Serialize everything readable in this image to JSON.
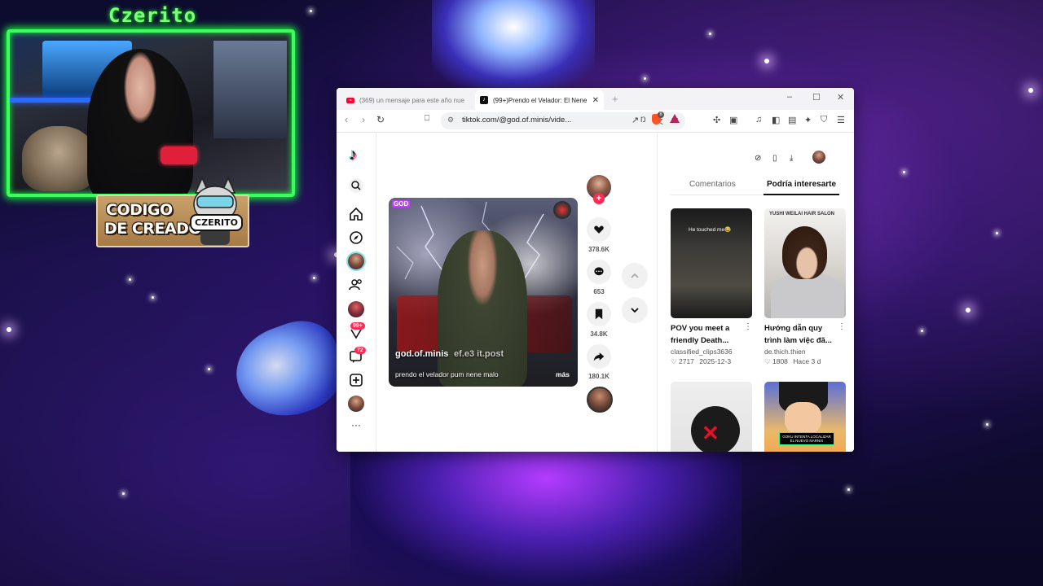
{
  "overlay": {
    "streamer_name": "Czerito",
    "badge_line1": "CODIGO",
    "badge_line2": "DE CREADOR",
    "badge_tag": "CZERITO"
  },
  "browser": {
    "tabs": [
      {
        "title": "(369) un mensaje para este año nue",
        "icon": "youtube-icon",
        "active": false
      },
      {
        "title": "(99+)Prendo el Velador: El Nene",
        "icon": "tiktok-icon",
        "active": true
      }
    ],
    "new_tab": "+",
    "url": "tiktok.com/@god.of.minis/vide...",
    "window_controls": {
      "minimize": "–",
      "maximize": "☐",
      "close": "✕"
    }
  },
  "tiktok": {
    "logo": "♪",
    "nav": {
      "messages_badge": "99+",
      "inbox_badge": "72",
      "more": "···"
    },
    "video": {
      "username": "god.of.minis",
      "overlay_ghost": "ef.e3 it.post",
      "description": "prendo el velador pum nene malo",
      "more_label": "más",
      "corner_tag": "GOD"
    },
    "actions": {
      "likes": "378.6K",
      "comments": "653",
      "saves": "34.8K",
      "shares": "180.1K"
    },
    "right_panel": {
      "tabs": [
        "Comentarios",
        "Podría interesarte"
      ],
      "active_tab": 1,
      "cards": [
        {
          "title": "POV you meet a friendly Death...",
          "user": "classified_clips3636",
          "likes": "2717",
          "date": "2025-12-3",
          "thumb_text": "He touched me😂"
        },
        {
          "title": "Hướng dẫn quy trình làm việc đã...",
          "user": "de.thich.thien",
          "likes": "1808",
          "date": "Hace 3 d",
          "thumb_text": "YUSHI WEILAI HAIR SALON"
        },
        {
          "title": "",
          "user": "",
          "likes": "",
          "date": "",
          "thumb_text": ""
        },
        {
          "title": "",
          "user": "",
          "likes": "",
          "date": "",
          "thumb_text": "GOKU INTENTA LOCALIZAR EL NUEVO NARNIX"
        }
      ]
    }
  }
}
